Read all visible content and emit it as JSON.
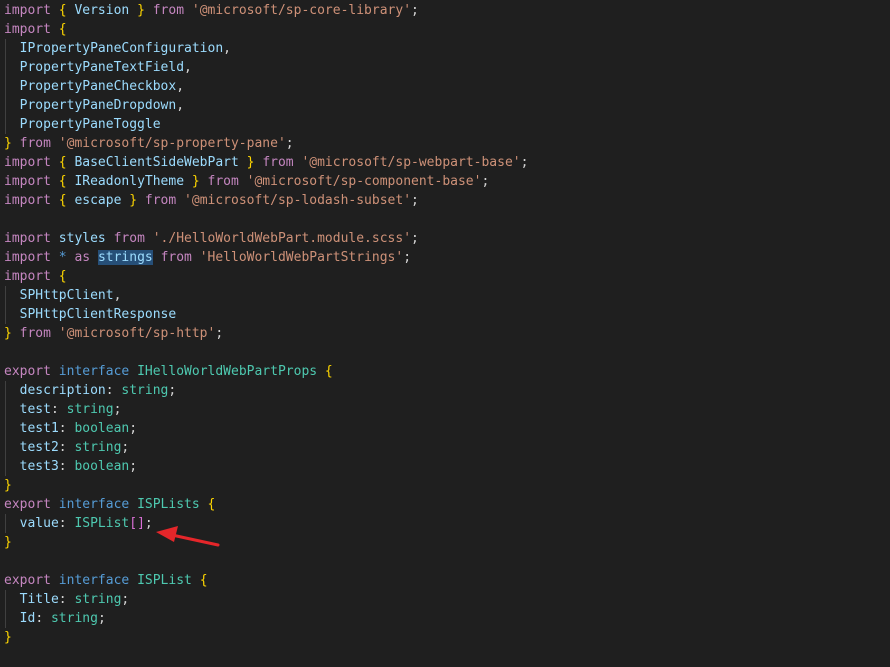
{
  "editor": {
    "theme_colors": {
      "background": "#1f1f1f",
      "keyword": "#c586c0",
      "storage": "#569cd6",
      "string": "#ce9178",
      "type": "#4ec9b0",
      "variable": "#9cdcfe",
      "bracket_level1": "#ffd700",
      "bracket_level2": "#da70d6",
      "bracket_level3": "#179fff",
      "selection": "#264f78",
      "annotation_arrow": "#e5262a"
    },
    "lines": [
      [
        {
          "t": "import",
          "c": "kw"
        },
        {
          "t": " "
        },
        {
          "t": "{",
          "c": "br1"
        },
        {
          "t": " "
        },
        {
          "t": "Version",
          "c": "var"
        },
        {
          "t": " "
        },
        {
          "t": "}",
          "c": "br1"
        },
        {
          "t": " "
        },
        {
          "t": "from",
          "c": "kw"
        },
        {
          "t": " "
        },
        {
          "t": "'@microsoft/sp-core-library'",
          "c": "str"
        },
        {
          "t": ";"
        }
      ],
      [
        {
          "t": "import",
          "c": "kw"
        },
        {
          "t": " "
        },
        {
          "t": "{",
          "c": "br1"
        }
      ],
      [
        {
          "t": "  "
        },
        {
          "t": "IPropertyPaneConfiguration",
          "c": "var"
        },
        {
          "t": ","
        }
      ],
      [
        {
          "t": "  "
        },
        {
          "t": "PropertyPaneTextField",
          "c": "var"
        },
        {
          "t": ","
        }
      ],
      [
        {
          "t": "  "
        },
        {
          "t": "PropertyPaneCheckbox",
          "c": "var"
        },
        {
          "t": ","
        }
      ],
      [
        {
          "t": "  "
        },
        {
          "t": "PropertyPaneDropdown",
          "c": "var"
        },
        {
          "t": ","
        }
      ],
      [
        {
          "t": "  "
        },
        {
          "t": "PropertyPaneToggle",
          "c": "var"
        }
      ],
      [
        {
          "t": "}",
          "c": "br1"
        },
        {
          "t": " "
        },
        {
          "t": "from",
          "c": "kw"
        },
        {
          "t": " "
        },
        {
          "t": "'@microsoft/sp-property-pane'",
          "c": "str"
        },
        {
          "t": ";"
        }
      ],
      [
        {
          "t": "import",
          "c": "kw"
        },
        {
          "t": " "
        },
        {
          "t": "{",
          "c": "br1"
        },
        {
          "t": " "
        },
        {
          "t": "BaseClientSideWebPart",
          "c": "var"
        },
        {
          "t": " "
        },
        {
          "t": "}",
          "c": "br1"
        },
        {
          "t": " "
        },
        {
          "t": "from",
          "c": "kw"
        },
        {
          "t": " "
        },
        {
          "t": "'@microsoft/sp-webpart-base'",
          "c": "str"
        },
        {
          "t": ";"
        }
      ],
      [
        {
          "t": "import",
          "c": "kw"
        },
        {
          "t": " "
        },
        {
          "t": "{",
          "c": "br1"
        },
        {
          "t": " "
        },
        {
          "t": "IReadonlyTheme",
          "c": "var"
        },
        {
          "t": " "
        },
        {
          "t": "}",
          "c": "br1"
        },
        {
          "t": " "
        },
        {
          "t": "from",
          "c": "kw"
        },
        {
          "t": " "
        },
        {
          "t": "'@microsoft/sp-component-base'",
          "c": "str"
        },
        {
          "t": ";"
        }
      ],
      [
        {
          "t": "import",
          "c": "kw"
        },
        {
          "t": " "
        },
        {
          "t": "{",
          "c": "br1"
        },
        {
          "t": " "
        },
        {
          "t": "escape",
          "c": "var"
        },
        {
          "t": " "
        },
        {
          "t": "}",
          "c": "br1"
        },
        {
          "t": " "
        },
        {
          "t": "from",
          "c": "kw"
        },
        {
          "t": " "
        },
        {
          "t": "'@microsoft/sp-lodash-subset'",
          "c": "str"
        },
        {
          "t": ";"
        }
      ],
      [],
      [
        {
          "t": "import",
          "c": "kw"
        },
        {
          "t": " "
        },
        {
          "t": "styles",
          "c": "var"
        },
        {
          "t": " "
        },
        {
          "t": "from",
          "c": "kw"
        },
        {
          "t": " "
        },
        {
          "t": "'./HelloWorldWebPart.module.scss'",
          "c": "str"
        },
        {
          "t": ";"
        }
      ],
      [
        {
          "t": "import",
          "c": "kw"
        },
        {
          "t": " "
        },
        {
          "t": "*",
          "c": "blue"
        },
        {
          "t": " "
        },
        {
          "t": "as",
          "c": "kw"
        },
        {
          "t": " "
        },
        {
          "t": "strings",
          "c": "var",
          "hl": true
        },
        {
          "t": " "
        },
        {
          "t": "from",
          "c": "kw"
        },
        {
          "t": " "
        },
        {
          "t": "'HelloWorldWebPartStrings'",
          "c": "str"
        },
        {
          "t": ";"
        }
      ],
      [
        {
          "t": "import",
          "c": "kw"
        },
        {
          "t": " "
        },
        {
          "t": "{",
          "c": "br1"
        }
      ],
      [
        {
          "t": "  "
        },
        {
          "t": "SPHttpClient",
          "c": "var"
        },
        {
          "t": ","
        }
      ],
      [
        {
          "t": "  "
        },
        {
          "t": "SPHttpClientResponse",
          "c": "var"
        }
      ],
      [
        {
          "t": "}",
          "c": "br1"
        },
        {
          "t": " "
        },
        {
          "t": "from",
          "c": "kw"
        },
        {
          "t": " "
        },
        {
          "t": "'@microsoft/sp-http'",
          "c": "str"
        },
        {
          "t": ";"
        }
      ],
      [],
      [
        {
          "t": "export",
          "c": "kw"
        },
        {
          "t": " "
        },
        {
          "t": "interface",
          "c": "blue"
        },
        {
          "t": " "
        },
        {
          "t": "IHelloWorldWebPartProps",
          "c": "type"
        },
        {
          "t": " "
        },
        {
          "t": "{",
          "c": "br1"
        }
      ],
      [
        {
          "t": "  "
        },
        {
          "t": "description",
          "c": "var"
        },
        {
          "t": ": "
        },
        {
          "t": "string",
          "c": "type"
        },
        {
          "t": ";"
        }
      ],
      [
        {
          "t": "  "
        },
        {
          "t": "test",
          "c": "var"
        },
        {
          "t": ": "
        },
        {
          "t": "string",
          "c": "type"
        },
        {
          "t": ";"
        }
      ],
      [
        {
          "t": "  "
        },
        {
          "t": "test1",
          "c": "var"
        },
        {
          "t": ": "
        },
        {
          "t": "boolean",
          "c": "type"
        },
        {
          "t": ";"
        }
      ],
      [
        {
          "t": "  "
        },
        {
          "t": "test2",
          "c": "var"
        },
        {
          "t": ": "
        },
        {
          "t": "string",
          "c": "type"
        },
        {
          "t": ";"
        }
      ],
      [
        {
          "t": "  "
        },
        {
          "t": "test3",
          "c": "var"
        },
        {
          "t": ": "
        },
        {
          "t": "boolean",
          "c": "type"
        },
        {
          "t": ";"
        }
      ],
      [
        {
          "t": "}",
          "c": "br1"
        }
      ],
      [
        {
          "t": "export",
          "c": "kw"
        },
        {
          "t": " "
        },
        {
          "t": "interface",
          "c": "blue"
        },
        {
          "t": " "
        },
        {
          "t": "ISPLists",
          "c": "type"
        },
        {
          "t": " "
        },
        {
          "t": "{",
          "c": "br1"
        }
      ],
      [
        {
          "t": "  "
        },
        {
          "t": "value",
          "c": "var"
        },
        {
          "t": ": "
        },
        {
          "t": "ISPList",
          "c": "type"
        },
        {
          "t": "[]",
          "c": "br2"
        },
        {
          "t": ";"
        }
      ],
      [
        {
          "t": "}",
          "c": "br1"
        }
      ],
      [],
      [
        {
          "t": "export",
          "c": "kw"
        },
        {
          "t": " "
        },
        {
          "t": "interface",
          "c": "blue"
        },
        {
          "t": " "
        },
        {
          "t": "ISPList",
          "c": "type"
        },
        {
          "t": " "
        },
        {
          "t": "{",
          "c": "br1"
        }
      ],
      [
        {
          "t": "  "
        },
        {
          "t": "Title",
          "c": "var"
        },
        {
          "t": ": "
        },
        {
          "t": "string",
          "c": "type"
        },
        {
          "t": ";"
        }
      ],
      [
        {
          "t": "  "
        },
        {
          "t": "Id",
          "c": "var"
        },
        {
          "t": ": "
        },
        {
          "t": "string",
          "c": "type"
        },
        {
          "t": ";"
        }
      ],
      [
        {
          "t": "}",
          "c": "br1"
        }
      ]
    ]
  },
  "annotation": {
    "icon": "red-arrow-icon"
  }
}
